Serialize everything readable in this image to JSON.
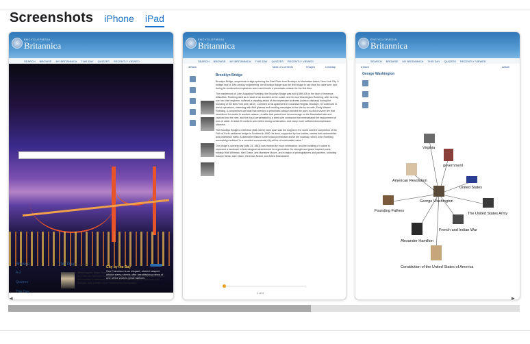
{
  "header": {
    "title": "Screenshots",
    "tabs": [
      {
        "label": "iPhone",
        "active": false
      },
      {
        "label": "iPad",
        "active": true
      }
    ]
  },
  "britannica": {
    "brand_small": "ENCYCLOPÆDIA",
    "brand": "Britannica",
    "nav": [
      "SEARCH",
      "BROWSE",
      "MY BRITANNICA",
      "THIS DAY",
      "QUIZZES",
      "RECENTLY VIEWED"
    ]
  },
  "shot1": {
    "caption_title": "City by the Bay",
    "caption": "San Francisco is an elegant, storied seaport whose steep streets offer breathtaking views of one of the world's great harbors",
    "browse": {
      "heading": "Browse",
      "items": [
        "A-Z",
        "Quizzes",
        "This Day"
      ]
    },
    "thisday": {
      "heading": "This Day",
      "date": "September 19",
      "item_title": "Washington Says Good-bye",
      "item_text": "In 1796 his Farewell Address (of 1796) Pres. George Washington urged his country to maintain neutrality and avoid entangling alliances with Europe, was printed in a Philadelphia newspaper."
    }
  },
  "shot2": {
    "back": "Back",
    "toc": "Table of Contents",
    "images": "Images",
    "linkmap": "LinkMap",
    "article_title": "Brooklyn Bridge",
    "p1": "Brooklyn Bridge, suspension bridge spanning the East River from Brooklyn to Manhattan Island, New York City. A brilliant feat of 19th-century engineering, the Brooklyn Bridge was the first bridge to use steel for cable wire, and during its construction explosives were used inside a pneumatic caisson for the first time.",
    "p2": "The masterwork of John Augustus Roebling, the Brooklyn Bridge was built (1869-83) in the face of immense difficulties. Roebling died as a result of an accident at the outset, and his son Washington Roebling, after serving over as chief engineer, suffered a crippling attack of decompression sickness (caisson disease) during the founding of the New York pier (1872). Confined to his apartment in Columbia Heights, Brooklyn, he continued to direct operations, observing with field glasses and sending messages to the site by his wife, Emily Warren Roebling. A compressed-air blast that wrecked a pneumatic caisson slowed the work, as did a severe fire that smoldered for weeks in another caisson, a cable that parted from its anchorage on the Manhattan side and crashed into the river, and the fraud perpetrated by a steel-wire contractor that necessitated the replacement of tons of cable. At least 20 workers were killed during construction, and many more suffered decompression sickness.",
    "p3": "The Brooklyn Bridge's 1,595-foot (486-metre) main span was the longest in the world until the completion of the Firth of Forth cantilever bridge in Scotland in 1890. Its deck, supported by four cables, carries both automobiles and pedestrian traffic. A distinctive feature is the broad promenade above the roadway, which John Roebling accurately predicted \"in a crowded commercial city will be of incalculable value.\"",
    "p4": "The bridge's opening day (May 24, 1883) was marked by much celebration, and the building of it came to represent a landmark in technological achievement for a generation. Its strength and grace inspired poets, notably Walt Whitman, Hart Crane, and Marianne Moore, and a legion of photographers and painters, including Joseph Stella, John Marin, Berenice Abbott, and Alfred Eisenstaedt.",
    "page_indicator": "1 of 4"
  },
  "shot3": {
    "back": "Back",
    "title": "George Washington",
    "article": "Article",
    "nodes": [
      "Virginia",
      "government",
      "American Revolution",
      "United States",
      "George Washington",
      "Founding Fathers",
      "The United States Army",
      "French and Indian War",
      "Alexander Hamilton",
      "Constitution of the United States of America"
    ]
  },
  "colors": {
    "accent": "#1a73c8",
    "brit_blue": "#2f77b8",
    "bridge": "#e8542a"
  }
}
